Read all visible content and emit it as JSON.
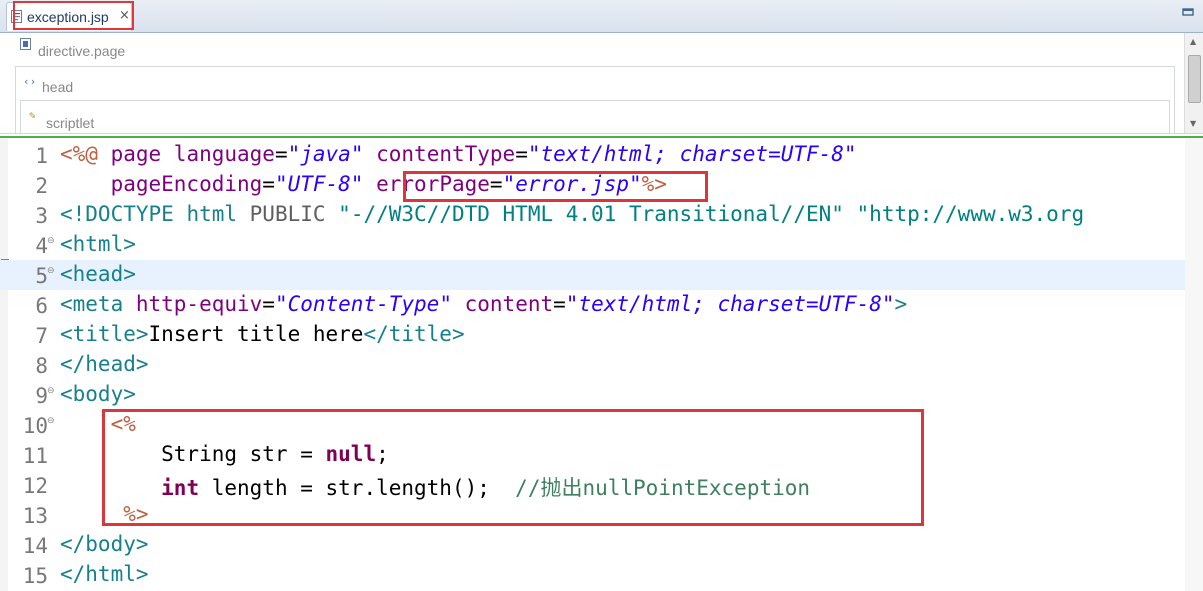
{
  "tab": {
    "label": "exception.jsp",
    "close": "×"
  },
  "design": {
    "directive": "directive.page",
    "head": "head",
    "scriptlet": "scriptlet"
  },
  "editor": {
    "lines": [
      {
        "num": "1",
        "tokens": [
          [
            "dir",
            "<%@ "
          ],
          [
            "attr",
            "page "
          ],
          [
            "attr",
            "language"
          ],
          [
            "plain",
            "="
          ],
          [
            "val",
            "\"java\""
          ],
          [
            "plain",
            " "
          ],
          [
            "attr",
            "contentType"
          ],
          [
            "plain",
            "="
          ],
          [
            "val",
            "\"text/html; charset=UTF-8\""
          ]
        ]
      },
      {
        "num": "2",
        "tokens": [
          [
            "plain",
            "    "
          ],
          [
            "attr",
            "pageEncoding"
          ],
          [
            "plain",
            "="
          ],
          [
            "val",
            "\"UTF-8\""
          ],
          [
            "plain",
            " "
          ],
          [
            "attr",
            "errorPage"
          ],
          [
            "plain",
            "="
          ],
          [
            "val",
            "\"error.jsp\""
          ],
          [
            "dir",
            "%>"
          ]
        ]
      },
      {
        "num": "3",
        "tokens": [
          [
            "tag",
            "<!DOCTYPE "
          ],
          [
            "tag",
            "html "
          ],
          [
            "doc",
            "PUBLIC "
          ],
          [
            "dtd",
            "\"-//W3C//DTD HTML 4.01 Transitional//EN\" \"http://www.w3.org"
          ]
        ]
      },
      {
        "num": "4",
        "fold": "⊖",
        "tokens": [
          [
            "tag",
            "<html>"
          ]
        ]
      },
      {
        "num": "5",
        "fold": "⊖",
        "current": true,
        "tokens": [
          [
            "tag",
            "<head>"
          ]
        ]
      },
      {
        "num": "6",
        "tokens": [
          [
            "tag",
            "<meta "
          ],
          [
            "attr",
            "http-equiv"
          ],
          [
            "plain",
            "="
          ],
          [
            "val",
            "\"Content-Type\""
          ],
          [
            "plain",
            " "
          ],
          [
            "attr",
            "content"
          ],
          [
            "plain",
            "="
          ],
          [
            "val",
            "\"text/html; charset=UTF-8\""
          ],
          [
            "tag",
            ">"
          ]
        ]
      },
      {
        "num": "7",
        "tokens": [
          [
            "tag",
            "<title>"
          ],
          [
            "plain",
            "Insert title here"
          ],
          [
            "tag",
            "</title>"
          ]
        ]
      },
      {
        "num": "8",
        "tokens": [
          [
            "tag",
            "</head>"
          ]
        ]
      },
      {
        "num": "9",
        "fold": "⊖",
        "tokens": [
          [
            "tag",
            "<body>"
          ]
        ]
      },
      {
        "num": "10",
        "fold": "⊖",
        "tokens": [
          [
            "plain",
            "    "
          ],
          [
            "dir",
            "<%"
          ]
        ]
      },
      {
        "num": "11",
        "tokens": [
          [
            "plain",
            "        String str = "
          ],
          [
            "kw",
            "null"
          ],
          [
            "plain",
            ";"
          ]
        ]
      },
      {
        "num": "12",
        "tokens": [
          [
            "plain",
            "        "
          ],
          [
            "kw",
            "int"
          ],
          [
            "plain",
            " length = str.length();  "
          ],
          [
            "cmt",
            "//抛出nullPointException"
          ]
        ]
      },
      {
        "num": "13",
        "tokens": [
          [
            "plain",
            "     "
          ],
          [
            "dir",
            "%>"
          ]
        ]
      },
      {
        "num": "14",
        "tokens": [
          [
            "tag",
            "</body>"
          ]
        ]
      },
      {
        "num": "15",
        "tokens": [
          [
            "tag",
            "</html>"
          ]
        ]
      }
    ]
  },
  "colors": {
    "highlight_box": "#d9363e",
    "editor_border": "#49b04a",
    "current_line": "#e8f2fe"
  }
}
